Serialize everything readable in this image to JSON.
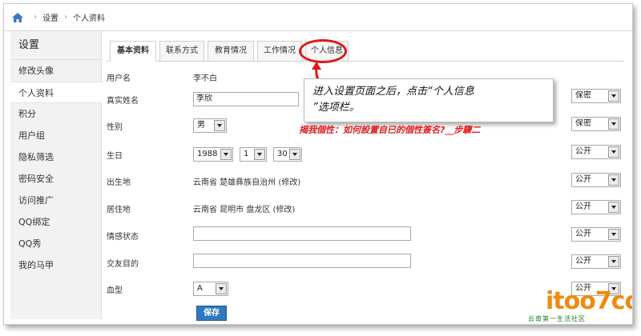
{
  "breadcrumb": {
    "items": [
      "设置",
      "个人资料"
    ]
  },
  "sidebar": {
    "title": "设置",
    "items": [
      {
        "label": "修改头像"
      },
      {
        "label": "个人资料"
      },
      {
        "label": "积分"
      },
      {
        "label": "用户组"
      },
      {
        "label": "隐私筛选"
      },
      {
        "label": "密码安全"
      },
      {
        "label": "访问推广"
      },
      {
        "label": "QQ绑定"
      },
      {
        "label": "QQ秀"
      },
      {
        "label": "我的马甲"
      }
    ]
  },
  "tabs": [
    {
      "label": "基本资料"
    },
    {
      "label": "联系方式"
    },
    {
      "label": "教育情况"
    },
    {
      "label": "工作情况"
    },
    {
      "label": "个人信息"
    }
  ],
  "form": {
    "username_label": "用户名",
    "username_value": "李不白",
    "realname_label": "真实姓名",
    "realname_value": "李欣",
    "gender_label": "性别",
    "gender_value": "男",
    "birthday_label": "生日",
    "birth_year": "1988",
    "birth_month": "1",
    "birth_day": "30",
    "birthplace_label": "出生地",
    "birthplace_value": "云南省 楚雄彝族自治州 (修改)",
    "residence_label": "居住地",
    "residence_value": "云南省 昆明市 盘龙区 (修改)",
    "relationship_label": "情感状态",
    "purpose_label": "交友目的",
    "blood_label": "血型",
    "blood_value": "A",
    "save_label": "保存"
  },
  "privacy": [
    "保密",
    "保密",
    "公开",
    "公开",
    "公开",
    "公开",
    "公开",
    "公开"
  ],
  "callout": {
    "line1": "进入设置页面之后，点击“个人信息",
    "line2": "”选项栏。"
  },
  "banner": "揭我個性：如何設置自已的個性簽名?__步驟二",
  "logo": {
    "main": "itoo7com",
    "sub": "云南第一生活社区"
  }
}
